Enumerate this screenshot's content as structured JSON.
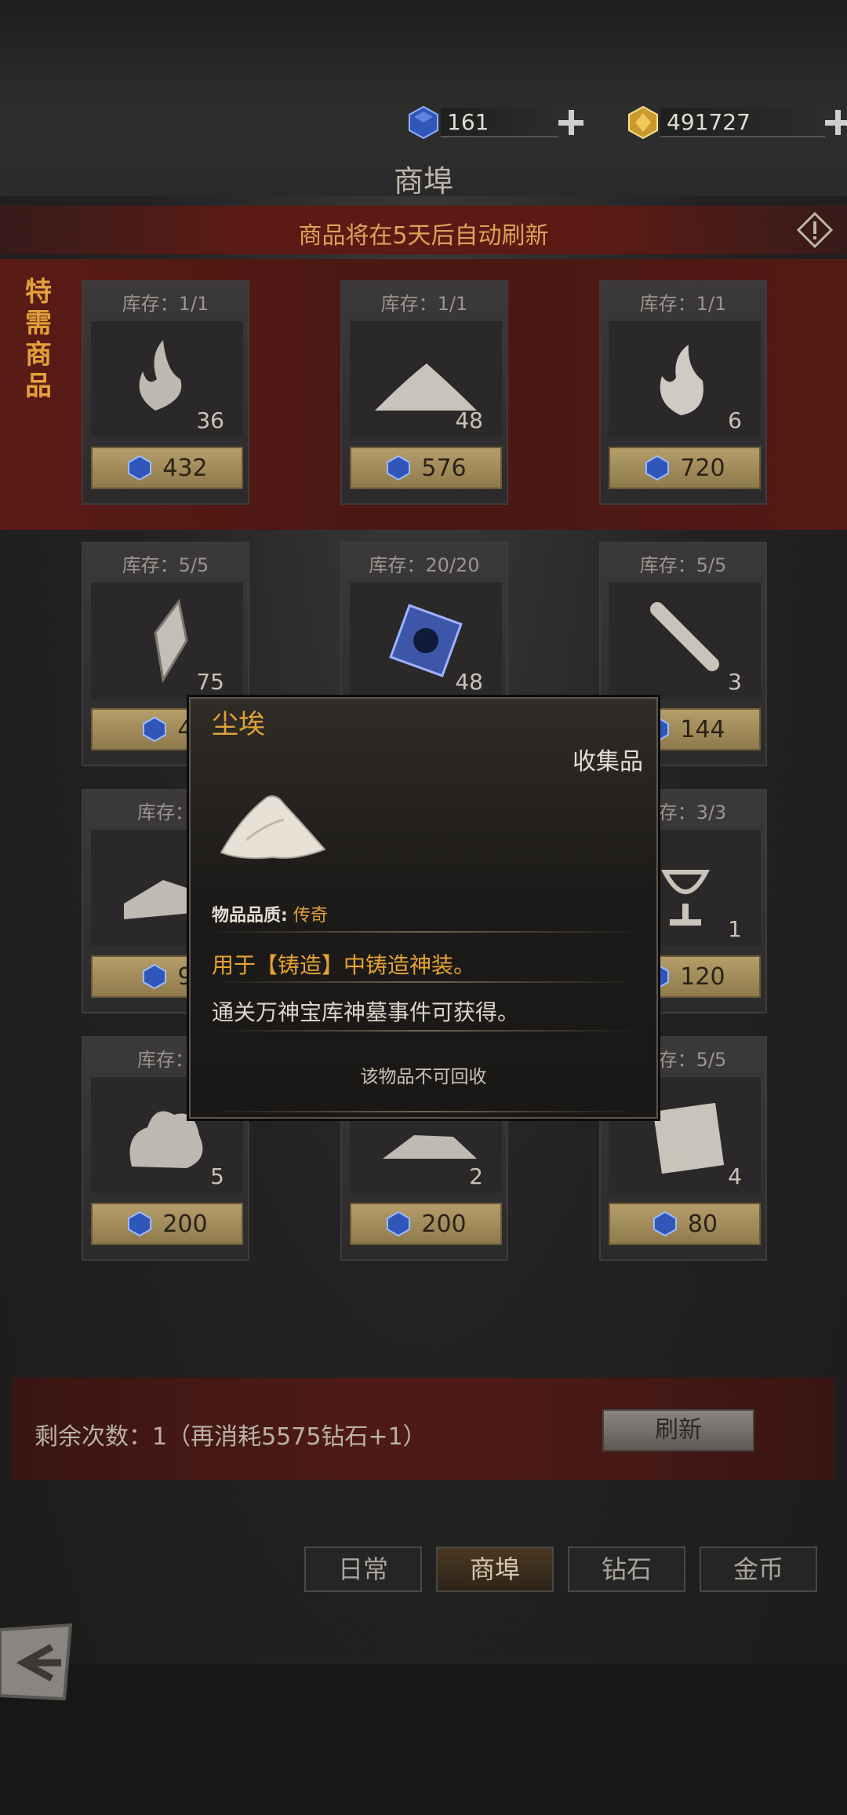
{
  "currency": {
    "diamond": {
      "value": "161",
      "icon": "blue-gem-icon"
    },
    "gold": {
      "value": "491727",
      "icon": "gold-gem-icon"
    }
  },
  "page_title": "商埠",
  "banner_text": "商品将在5天后自动刷新",
  "special_label": [
    "特",
    "需",
    "商",
    "品"
  ],
  "items": [
    {
      "stock": "库存：1/1",
      "count": "36",
      "price": "432",
      "icon": "flame-swirl-icon"
    },
    {
      "stock": "库存：1/1",
      "count": "48",
      "price": "576",
      "icon": "dust-pile-icon"
    },
    {
      "stock": "库存：1/1",
      "count": "6",
      "price": "720",
      "icon": "fire-icon"
    },
    {
      "stock": "库存：5/5",
      "count": "75",
      "price": "4",
      "icon": "crystal-shard-icon"
    },
    {
      "stock": "库存：20/20",
      "count": "48",
      "price": "",
      "icon": "blue-cube-icon"
    },
    {
      "stock": "库存：5/5",
      "count": "3",
      "price": "144",
      "icon": "bone-club-icon"
    },
    {
      "stock": "库存：",
      "count": "",
      "price": "9",
      "icon": "stone-slab-icon"
    },
    {
      "stock": "",
      "count": "",
      "price": "",
      "icon": ""
    },
    {
      "stock": "库存：3/3",
      "count": "1",
      "price": "120",
      "icon": "chalice-icon"
    },
    {
      "stock": "库存：",
      "count": "5",
      "price": "200",
      "icon": "flame-cloud-icon"
    },
    {
      "stock": "",
      "count": "2",
      "price": "200",
      "icon": "rubble-icon"
    },
    {
      "stock": "库存：5/5",
      "count": "4",
      "price": "80",
      "icon": "map-scroll-icon"
    }
  ],
  "refresh": {
    "remaining_text": "剩余次数：1（再消耗5575钻石+1）",
    "button_label": "刷新"
  },
  "tabs": [
    {
      "label": "日常",
      "active": false
    },
    {
      "label": "商埠",
      "active": true
    },
    {
      "label": "钻石",
      "active": false
    },
    {
      "label": "金币",
      "active": false
    }
  ],
  "popup": {
    "name": "尘埃",
    "type": "收集品",
    "quality_label": "物品品质:",
    "quality_value": "传奇",
    "usage": "用于【铸造】中铸造神装。",
    "source": "通关万神宝库神墓事件可获得。",
    "recycle_note": "该物品不可回收"
  },
  "colors": {
    "accent_gold": "#e0a33b",
    "banner_red": "#5c1a14",
    "price_tag": "#b59e6a"
  }
}
